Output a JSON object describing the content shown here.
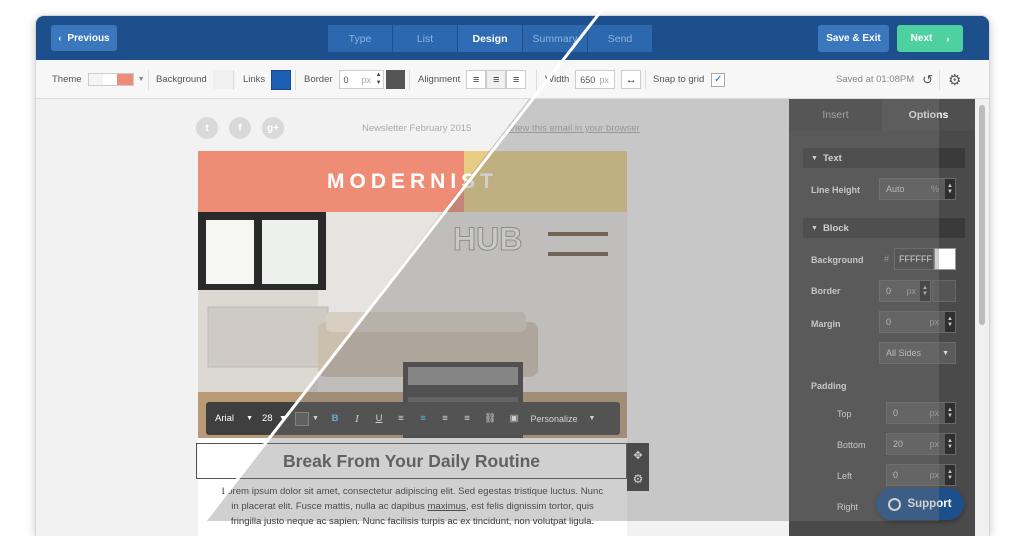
{
  "topbar": {
    "prev_label": "Previous",
    "steps": [
      {
        "label": "Type",
        "active": false
      },
      {
        "label": "List",
        "active": false
      },
      {
        "label": "Design",
        "active": true
      },
      {
        "label": "Summary",
        "active": false
      },
      {
        "label": "Send",
        "active": false
      }
    ],
    "save_label": "Save & Exit",
    "next_label": "Next"
  },
  "toolbar": {
    "theme_label": "Theme",
    "background_label": "Background",
    "links_label": "Links",
    "border_label": "Border",
    "border_value": "0",
    "border_unit": "px",
    "alignment_label": "Alignment",
    "width_label": "Width",
    "width_value": "650",
    "width_unit": "px",
    "snap_label": "Snap to grid",
    "snap_checked": true,
    "saved_text": "Saved at 01:08PM",
    "colors": {
      "links": "#1f5fb3",
      "border": "#555555",
      "theme": "#ef8c76"
    }
  },
  "canvas": {
    "social_icons": [
      "twitter-icon",
      "facebook-icon",
      "google-plus-icon"
    ],
    "social_glyphs": [
      "t",
      "f",
      "g+"
    ],
    "newsletter_text": "Newsletter February 2015",
    "view_link": "View this email in your browser",
    "banner_text": "MODERNIST",
    "photo_text": "HUB",
    "heading": "Break From Your Daily Routine",
    "body_lines": [
      "Lorem ipsum dolor sit amet, consectetur adipiscing elit. Sed egestas tristique luctus. Nunc",
      "in placerat elit. Fusce mattis, nulla ac dapibus maximus, est felis dignissim tortor, quis",
      "fringilla justo neque ac sapien. Nunc facilisis turpis ac ex tincidunt, non volutpat ligula."
    ],
    "body_underlined_word": "maximus",
    "format_toolbar": {
      "font": "Arial",
      "size": "28",
      "bold": "B",
      "italic": "I",
      "underline": "U",
      "personalize": "Personalize"
    }
  },
  "panel": {
    "tabs": [
      {
        "label": "Insert",
        "active": false
      },
      {
        "label": "Options",
        "active": true
      }
    ],
    "text_section": "Text",
    "line_height_label": "Line Height",
    "line_height_value": "Auto",
    "line_height_unit": "%",
    "block_section": "Block",
    "background_label": "Background",
    "background_hash": "#",
    "background_value": "FFFFFF",
    "border_label": "Border",
    "border_value": "0",
    "border_unit": "px",
    "margin_label": "Margin",
    "margin_value": "0",
    "margin_unit": "px",
    "margin_sides": "All Sides",
    "padding_label": "Padding",
    "padding_top_label": "Top",
    "padding_top_value": "0",
    "padding_bottom_label": "Bottom",
    "padding_bottom_value": "20",
    "padding_left_label": "Left",
    "padding_left_value": "0",
    "padding_right_label": "Right",
    "padding_unit": "px"
  },
  "support_label": "Support"
}
